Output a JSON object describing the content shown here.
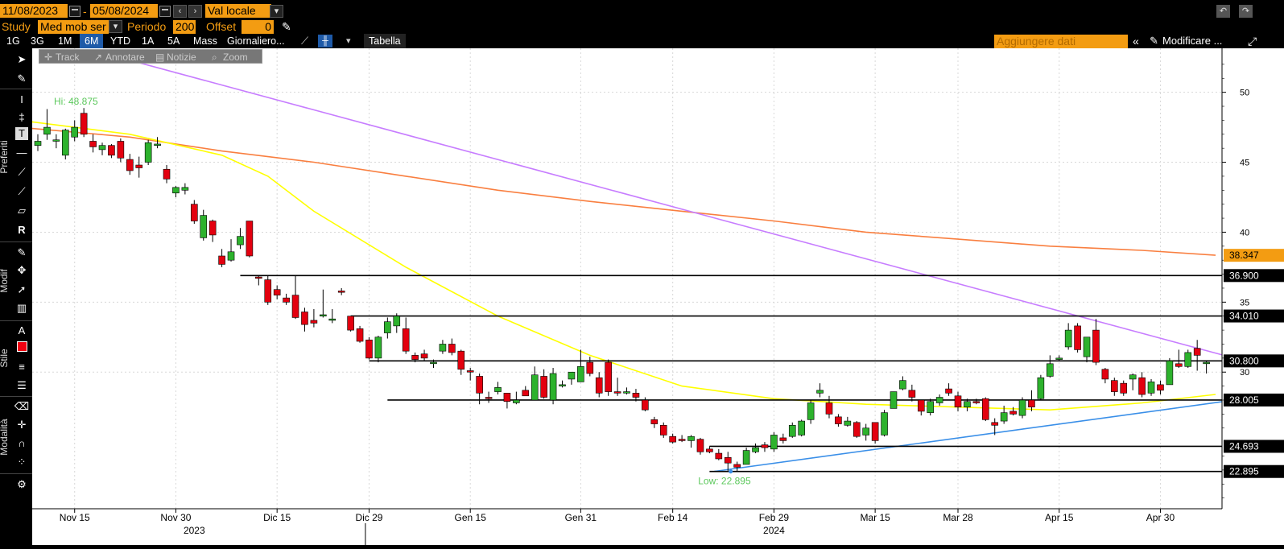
{
  "header": {
    "start_date": "11/08/2023",
    "end_date": "05/08/2024",
    "separator": "-",
    "currency": "Val locale",
    "study_label": "Study",
    "study_value": "Med mob ser",
    "period_label": "Periodo",
    "period_value": "200",
    "offset_label": "Offset",
    "offset_value": "0"
  },
  "tabs": [
    {
      "label": "1G"
    },
    {
      "label": "3G"
    },
    {
      "label": "1M"
    },
    {
      "label": "6M",
      "active": true
    },
    {
      "label": "YTD"
    },
    {
      "label": "1A"
    },
    {
      "label": "5A"
    },
    {
      "label": "Mass"
    },
    {
      "label": "Giornaliero..."
    }
  ],
  "toolbar_right": {
    "tabella": "Tabella",
    "add_data_placeholder": "Aggiungere dati",
    "modify": "Modificare ..."
  },
  "chart_toolbar": {
    "track": "Track",
    "annotate": "Annotare",
    "notes": "Notizie",
    "zoom": "Zoom"
  },
  "sidebar": {
    "favorites": "Preferiti",
    "modify": "Modif",
    "style": "Stile",
    "mode": "Modalità"
  },
  "chart_data": {
    "type": "candlestick",
    "ylim": [
      19.8,
      53
    ],
    "yticks": [
      30,
      35,
      40,
      45,
      50
    ],
    "x_ticks": [
      {
        "label": "Nov 15",
        "t": 4
      },
      {
        "label": "Nov 30",
        "t": 15
      },
      {
        "label": "Dic 15",
        "t": 26
      },
      {
        "label": "Dic 29",
        "t": 36
      },
      {
        "label": "Gen 15",
        "t": 47
      },
      {
        "label": "Gen 31",
        "t": 59
      },
      {
        "label": "Feb 14",
        "t": 69
      },
      {
        "label": "Feb 29",
        "t": 80
      },
      {
        "label": "Mar 15",
        "t": 91
      },
      {
        "label": "Mar 28",
        "t": 100
      },
      {
        "label": "Apr 15",
        "t": 111
      },
      {
        "label": "Apr 30",
        "t": 122
      }
    ],
    "year_labels": [
      {
        "label": "2023",
        "t": 17
      },
      {
        "label": "2024",
        "t": 80
      }
    ],
    "hi_label": "Hi: 48.875",
    "low_label": "Low: 22.895",
    "price_levels": [
      {
        "value": 38.347,
        "label": "38.347",
        "color": "#f39c12"
      },
      {
        "value": 36.9,
        "label": "36.900",
        "color": "#000000"
      },
      {
        "value": 34.01,
        "label": "34.010",
        "color": "#000000"
      },
      {
        "value": 30.8,
        "label": "30.800",
        "color": "#000000"
      },
      {
        "value": 28.005,
        "label": "28.005",
        "color": "#000000"
      },
      {
        "value": 24.693,
        "label": "24.693",
        "color": "#000000"
      },
      {
        "value": 22.895,
        "label": "22.895",
        "color": "#000000"
      }
    ],
    "hlines": [
      {
        "value": 36.9,
        "t_start": 22
      },
      {
        "value": 34.01,
        "t_start": 34
      },
      {
        "value": 30.8,
        "t_start": 36
      },
      {
        "value": 28.005,
        "t_start": 38
      },
      {
        "value": 24.693,
        "t_start": 73
      },
      {
        "value": 22.895,
        "t_start": 73
      }
    ],
    "trendlines": [
      {
        "name": "resistance",
        "color": "#c77dff",
        "points": [
          [
            6,
            53
          ],
          [
            130,
            31.0
          ]
        ]
      },
      {
        "name": "support",
        "color": "#3a8fe8",
        "points": [
          [
            73.5,
            22.9
          ],
          [
            130,
            28.0
          ]
        ]
      }
    ],
    "ma_series": [
      {
        "color": "#f97f40",
        "points": [
          [
            -2,
            47.5
          ],
          [
            10,
            46.8
          ],
          [
            20,
            45.8
          ],
          [
            30,
            45.0
          ],
          [
            40,
            44.0
          ],
          [
            50,
            43.0
          ],
          [
            60,
            42.2
          ],
          [
            70,
            41.5
          ],
          [
            80,
            40.8
          ],
          [
            90,
            40.0
          ],
          [
            100,
            39.5
          ],
          [
            110,
            39.0
          ],
          [
            120,
            38.7
          ],
          [
            128,
            38.35
          ]
        ]
      },
      {
        "color": "#ffff00",
        "points": [
          [
            -2,
            48.0
          ],
          [
            10,
            47.0
          ],
          [
            20,
            45.5
          ],
          [
            25,
            44.0
          ],
          [
            30,
            41.5
          ],
          [
            40,
            37.5
          ],
          [
            50,
            34.0
          ],
          [
            60,
            31.2
          ],
          [
            70,
            29.0
          ],
          [
            80,
            28.1
          ],
          [
            90,
            27.7
          ],
          [
            100,
            27.5
          ],
          [
            105,
            27.4
          ],
          [
            110,
            27.3
          ],
          [
            120,
            27.8
          ],
          [
            128,
            28.4
          ]
        ]
      }
    ],
    "candles": [
      [
        0,
        46.2,
        47.0,
        45.8,
        46.5
      ],
      [
        1,
        47.0,
        48.8,
        46.6,
        47.5
      ],
      [
        2,
        46.5,
        47.0,
        46.0,
        46.6
      ],
      [
        3,
        45.5,
        47.4,
        45.2,
        47.3
      ],
      [
        4,
        46.8,
        48.0,
        46.5,
        47.5
      ],
      [
        5,
        48.5,
        48.875,
        46.8,
        47.0
      ],
      [
        6,
        46.5,
        47.0,
        45.7,
        46.1
      ],
      [
        7,
        45.9,
        46.4,
        45.5,
        46.2
      ],
      [
        8,
        46.2,
        46.3,
        45.3,
        45.5
      ],
      [
        9,
        46.5,
        46.7,
        45.0,
        45.3
      ],
      [
        10,
        45.2,
        45.6,
        44.1,
        44.4
      ],
      [
        11,
        44.8,
        45.4,
        43.9,
        44.6
      ],
      [
        12,
        45.0,
        46.6,
        44.8,
        46.4
      ],
      [
        13,
        46.2,
        46.8,
        46.0,
        46.3
      ],
      [
        14,
        44.5,
        44.8,
        43.5,
        43.8
      ],
      [
        15,
        42.8,
        43.3,
        42.5,
        43.2
      ],
      [
        16,
        43.0,
        43.5,
        42.7,
        43.2
      ],
      [
        17,
        42.0,
        42.3,
        40.6,
        40.8
      ],
      [
        18,
        39.6,
        41.6,
        39.4,
        41.2
      ],
      [
        19,
        40.8,
        40.9,
        39.3,
        39.8
      ],
      [
        20,
        38.3,
        38.8,
        37.5,
        37.7
      ],
      [
        21,
        38.0,
        39.5,
        37.9,
        38.6
      ],
      [
        22,
        39.1,
        40.3,
        38.8,
        39.7
      ],
      [
        23,
        40.8,
        40.8,
        38.2,
        38.3
      ],
      [
        24,
        36.8,
        36.9,
        36.2,
        36.7
      ],
      [
        25,
        36.6,
        36.9,
        34.8,
        35.0
      ],
      [
        26,
        35.9,
        36.2,
        35.2,
        35.5
      ],
      [
        27,
        35.3,
        35.6,
        34.8,
        35.0
      ],
      [
        28,
        35.5,
        36.9,
        33.8,
        33.9
      ],
      [
        29,
        34.3,
        34.6,
        32.9,
        33.4
      ],
      [
        30,
        33.7,
        34.5,
        33.2,
        33.5
      ],
      [
        31,
        34.0,
        35.9,
        33.9,
        34.1
      ],
      [
        32,
        33.7,
        34.5,
        33.5,
        33.8
      ],
      [
        33,
        35.8,
        36.0,
        35.5,
        35.7
      ],
      [
        34,
        34.0,
        34.0,
        32.9,
        33.0
      ],
      [
        35,
        33.1,
        33.3,
        32.1,
        32.2
      ],
      [
        36,
        32.3,
        32.5,
        30.9,
        31.0
      ],
      [
        37,
        31.0,
        32.6,
        30.7,
        32.5
      ],
      [
        38,
        32.8,
        33.9,
        32.4,
        33.6
      ],
      [
        39,
        33.3,
        34.2,
        32.8,
        34.0
      ],
      [
        40,
        33.1,
        33.9,
        31.3,
        31.5
      ],
      [
        41,
        31.2,
        31.4,
        30.7,
        30.9
      ],
      [
        42,
        31.3,
        31.6,
        30.8,
        31.0
      ],
      [
        43,
        30.6,
        30.9,
        30.3,
        30.7
      ],
      [
        44,
        31.5,
        32.3,
        31.3,
        32.0
      ],
      [
        45,
        32.0,
        32.4,
        31.2,
        31.4
      ],
      [
        46,
        31.5,
        31.6,
        29.8,
        30.2
      ],
      [
        47,
        30.1,
        30.3,
        29.4,
        30.0
      ],
      [
        48,
        29.7,
        29.9,
        27.7,
        28.5
      ],
      [
        49,
        28.2,
        28.6,
        27.8,
        28.1
      ],
      [
        50,
        28.6,
        29.3,
        28.4,
        28.9
      ],
      [
        51,
        28.5,
        28.5,
        27.4,
        27.9
      ],
      [
        52,
        27.8,
        28.6,
        27.7,
        28.0
      ],
      [
        53,
        28.7,
        29.0,
        28.4,
        28.3
      ],
      [
        54,
        28.0,
        30.4,
        28.0,
        29.8
      ],
      [
        55,
        29.7,
        30.2,
        28.1,
        28.2
      ],
      [
        56,
        28.0,
        30.3,
        27.7,
        29.9
      ],
      [
        57,
        29.0,
        29.4,
        28.9,
        29.1
      ],
      [
        58,
        29.5,
        29.8,
        29.1,
        30.0
      ],
      [
        59,
        29.3,
        31.6,
        29.3,
        30.4
      ],
      [
        60,
        30.7,
        31.1,
        29.7,
        29.9
      ],
      [
        61,
        29.6,
        30.0,
        28.2,
        28.5
      ],
      [
        62,
        30.7,
        30.9,
        28.3,
        28.6
      ],
      [
        63,
        28.6,
        29.6,
        28.3,
        28.5
      ],
      [
        64,
        28.5,
        28.9,
        28.4,
        28.6
      ],
      [
        65,
        28.5,
        28.8,
        27.9,
        28.2
      ],
      [
        66,
        28.0,
        28.2,
        27.2,
        27.3
      ],
      [
        67,
        26.6,
        26.8,
        26.0,
        26.3
      ],
      [
        68,
        26.2,
        26.4,
        25.3,
        25.5
      ],
      [
        69,
        25.4,
        25.6,
        24.9,
        25.0
      ],
      [
        70,
        25.2,
        25.5,
        25.0,
        25.1
      ],
      [
        71,
        25.1,
        25.5,
        24.6,
        25.4
      ],
      [
        72,
        25.2,
        25.3,
        24.1,
        24.3
      ],
      [
        73,
        24.5,
        24.7,
        24.2,
        24.3
      ],
      [
        74,
        24.2,
        24.5,
        23.7,
        23.8
      ],
      [
        75,
        23.9,
        24.3,
        22.895,
        23.5
      ],
      [
        76,
        23.4,
        23.6,
        22.9,
        23.2
      ],
      [
        77,
        23.4,
        24.6,
        23.4,
        24.4
      ],
      [
        78,
        24.3,
        24.9,
        24.2,
        24.6
      ],
      [
        79,
        24.8,
        25.0,
        24.3,
        24.6
      ],
      [
        80,
        24.5,
        25.7,
        24.3,
        25.5
      ],
      [
        81,
        25.3,
        25.6,
        24.9,
        25.1
      ],
      [
        82,
        25.4,
        26.4,
        25.3,
        26.2
      ],
      [
        83,
        25.5,
        26.6,
        25.4,
        26.5
      ],
      [
        84,
        26.6,
        28.0,
        26.3,
        27.8
      ],
      [
        85,
        28.5,
        29.2,
        28.2,
        28.7
      ],
      [
        86,
        27.8,
        28.3,
        26.7,
        27.0
      ],
      [
        87,
        26.8,
        27.0,
        26.1,
        26.3
      ],
      [
        88,
        26.2,
        26.8,
        26.1,
        26.5
      ],
      [
        89,
        26.4,
        26.5,
        25.3,
        25.4
      ],
      [
        90,
        25.5,
        26.3,
        25.1,
        26.0
      ],
      [
        91,
        26.4,
        26.4,
        24.9,
        25.1
      ],
      [
        92,
        25.5,
        27.3,
        25.4,
        27.1
      ],
      [
        93,
        27.4,
        28.6,
        27.4,
        28.6
      ],
      [
        94,
        28.8,
        29.7,
        28.7,
        29.4
      ],
      [
        95,
        28.7,
        29.1,
        27.9,
        28.2
      ],
      [
        96,
        28.0,
        28.0,
        26.9,
        27.2
      ],
      [
        97,
        27.1,
        28.1,
        26.9,
        27.9
      ],
      [
        98,
        27.8,
        28.4,
        27.6,
        28.2
      ],
      [
        99,
        28.8,
        29.2,
        28.3,
        28.5
      ],
      [
        100,
        28.3,
        28.6,
        27.2,
        27.5
      ],
      [
        101,
        27.5,
        28.1,
        27.2,
        27.9
      ],
      [
        102,
        27.9,
        28.1,
        27.7,
        27.8
      ],
      [
        103,
        28.1,
        28.2,
        26.5,
        26.6
      ],
      [
        104,
        26.4,
        26.7,
        25.5,
        26.2
      ],
      [
        105,
        26.5,
        27.6,
        26.3,
        27.1
      ],
      [
        106,
        27.2,
        27.5,
        26.9,
        27.0
      ],
      [
        107,
        26.9,
        28.2,
        26.7,
        28.0
      ],
      [
        108,
        28.0,
        28.7,
        27.2,
        27.5
      ],
      [
        109,
        28.1,
        29.8,
        28.0,
        29.6
      ],
      [
        110,
        29.7,
        31.2,
        29.6,
        30.6
      ],
      [
        111,
        30.9,
        31.2,
        30.8,
        31.0
      ],
      [
        112,
        31.8,
        33.5,
        31.6,
        33.0
      ],
      [
        113,
        33.3,
        33.5,
        31.4,
        31.6
      ],
      [
        114,
        31.1,
        32.5,
        30.7,
        32.5
      ],
      [
        115,
        33.0,
        33.8,
        30.5,
        30.7
      ],
      [
        116,
        30.2,
        30.3,
        29.2,
        29.5
      ],
      [
        117,
        29.4,
        29.6,
        28.3,
        28.6
      ],
      [
        118,
        29.2,
        29.4,
        28.3,
        28.5
      ],
      [
        119,
        29.5,
        29.9,
        28.7,
        29.8
      ],
      [
        120,
        29.6,
        30.0,
        28.2,
        28.4
      ],
      [
        121,
        28.5,
        29.5,
        28.3,
        29.3
      ],
      [
        122,
        29.1,
        29.4,
        28.4,
        28.7
      ],
      [
        123,
        29.1,
        31.0,
        29.1,
        30.8
      ],
      [
        124,
        30.6,
        31.6,
        30.3,
        30.4
      ],
      [
        125,
        30.4,
        31.6,
        30.3,
        31.4
      ],
      [
        126,
        31.7,
        32.3,
        30.1,
        31.2
      ],
      [
        127,
        30.6,
        30.8,
        29.9,
        30.7
      ]
    ]
  }
}
